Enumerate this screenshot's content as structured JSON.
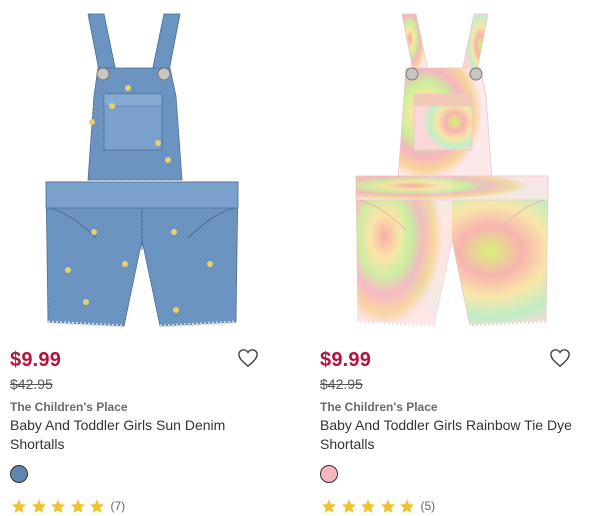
{
  "products": [
    {
      "image_alt": "Denim shortalls with embroidered suns",
      "price": "$9.99",
      "original_price": "$42.95",
      "brand": "The Children's Place",
      "title": "Baby And Toddler Girls Sun Denim Shortalls",
      "swatch_color": "#5f86ad",
      "rating": 5,
      "review_count": "(7)"
    },
    {
      "image_alt": "Rainbow tie dye shortalls",
      "price": "$9.99",
      "original_price": "$42.95",
      "brand": "The Children's Place",
      "title": "Baby And Toddler Girls Rainbow Tie Dye Shortalls",
      "swatch_color": "#f4b6bf",
      "rating": 5,
      "review_count": "(5)"
    }
  ],
  "colors": {
    "price_red": "#b5133b",
    "star_yellow": "#f2c12e"
  },
  "icons": {
    "favorite": "heart-outline-icon",
    "star": "star-icon"
  }
}
